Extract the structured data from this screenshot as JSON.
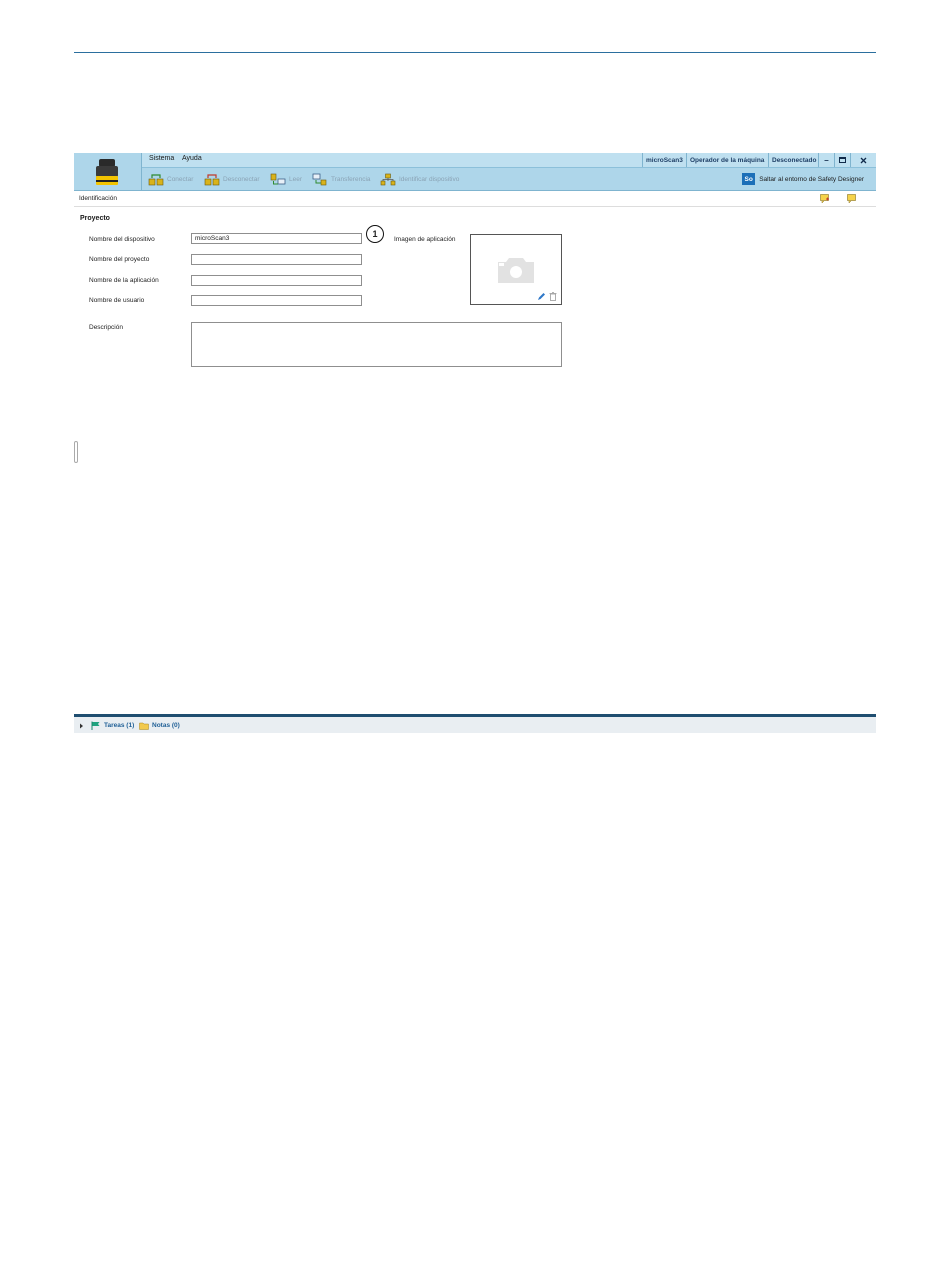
{
  "menu": {
    "items": [
      "Sistema",
      "Ayuda"
    ]
  },
  "status": {
    "device": "microScan3",
    "user": "Operador de la máquina",
    "connection": "Desconectado"
  },
  "toolbar": {
    "buttons": [
      "Conectar",
      "Desconectar",
      "Leer",
      "Transferencia",
      "Identificar dispositivo"
    ],
    "safety_badge": "So",
    "safety_label": "Saltar al entorno de Safety Designer"
  },
  "page": {
    "title": "Identificación"
  },
  "project": {
    "section_title": "Proyecto",
    "fields": [
      {
        "label": "Nombre del dispositivo",
        "value": "microScan3"
      },
      {
        "label": "Nombre del proyecto",
        "value": ""
      },
      {
        "label": "Nombre de la aplicación",
        "value": ""
      },
      {
        "label": "Nombre de usuario",
        "value": ""
      }
    ],
    "description_label": "Descripción",
    "image_label": "Imagen de aplicación",
    "callout": "1"
  },
  "bottom": {
    "tasks": "Tareas (1)",
    "notes": "Notas (0)"
  },
  "colors": {
    "header_bg": "#aed6ea",
    "accent": "#1f4e70",
    "badge": "#1c6fb8"
  }
}
